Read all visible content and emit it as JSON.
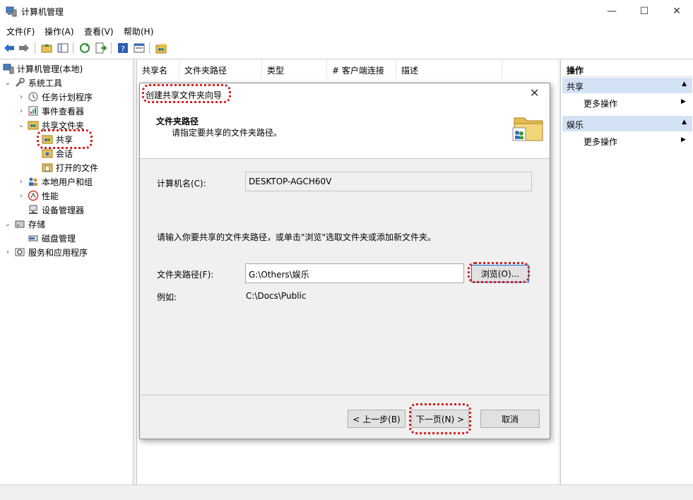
{
  "window": {
    "title": "计算机管理",
    "controls": {
      "minimize": "—",
      "maximize": "☐",
      "close": "✕"
    }
  },
  "menu": [
    "文件(F)",
    "操作(A)",
    "查看(V)",
    "帮助(H)"
  ],
  "tree": {
    "root": "计算机管理(本地)",
    "nodes": [
      "系统工具",
      "任务计划程序",
      "事件查看器",
      "共享文件夹",
      "共享",
      "会话",
      "打开的文件",
      "本地用户和组",
      "性能",
      "设备管理器",
      "存储",
      "磁盘管理",
      "服务和应用程序"
    ]
  },
  "list": {
    "columns": [
      "共享名",
      "文件夹路径",
      "类型",
      "# 客户端连接",
      "描述"
    ]
  },
  "actions": {
    "header": "操作",
    "sections": [
      {
        "title": "共享",
        "item": "更多操作"
      },
      {
        "title": "娱乐",
        "item": "更多操作"
      }
    ]
  },
  "dialog": {
    "title": "创建共享文件夹向导",
    "heading": "文件夹路径",
    "subheading": "请指定要共享的文件夹路径。",
    "computer_label": "计算机名(C):",
    "computer_value": "DESKTOP-AGCH60V",
    "instruction": "请输入你要共享的文件夹路径，或单击\"浏览\"选取文件夹或添加新文件夹。",
    "path_label": "文件夹路径(F):",
    "path_value": "G:\\Others\\娱乐",
    "browse_label": "浏览(O)...",
    "example_label": "例如:",
    "example_value": "C:\\Docs\\Public",
    "back_label": "< 上一步(B)",
    "next_label": "下一页(N) >",
    "cancel_label": "取消",
    "close": "✕"
  },
  "colors": {
    "highlight": "#d42020",
    "section_bg": "#d3e3f5"
  }
}
